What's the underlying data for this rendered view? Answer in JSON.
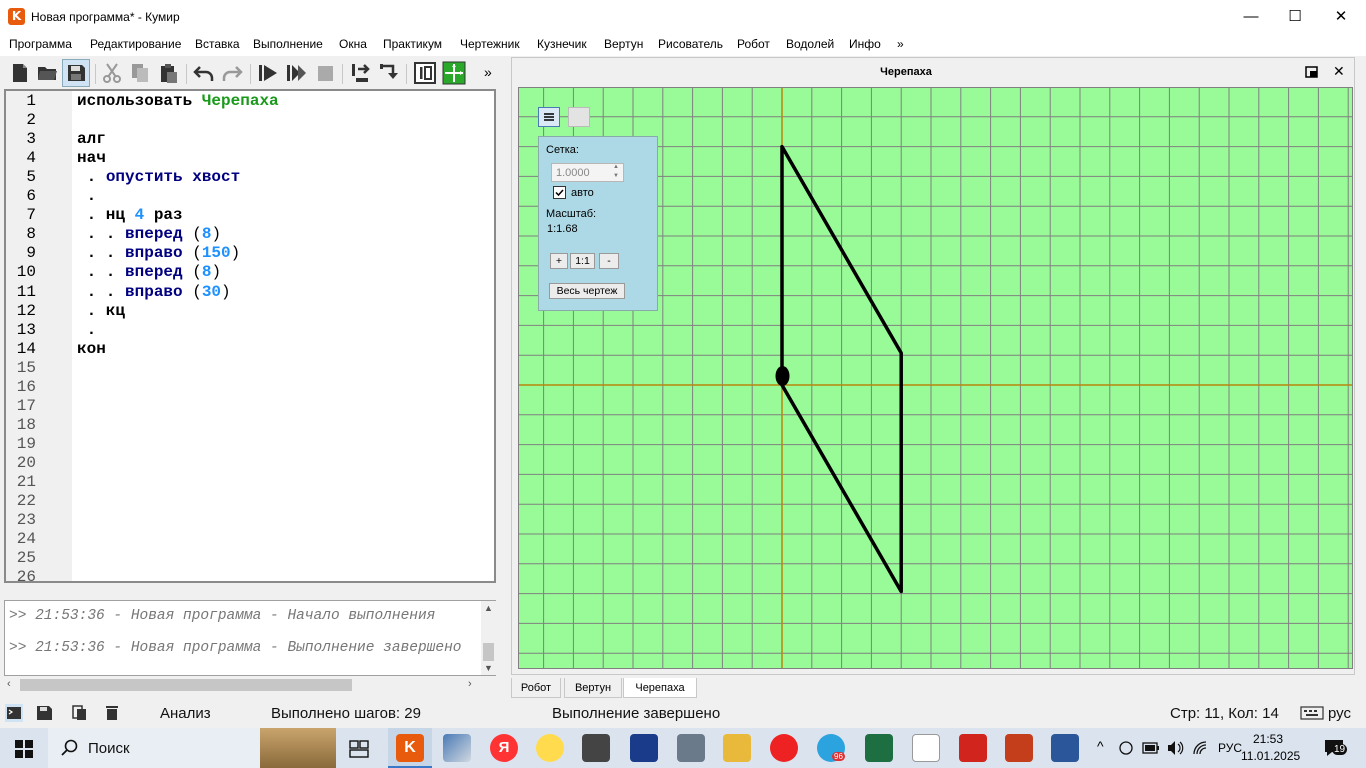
{
  "window": {
    "title": "Новая программа* - Кумир",
    "app_icon_letter": "K",
    "minimize": "—",
    "maximize": "☐",
    "close": "✕"
  },
  "menu": [
    "Программа",
    "Редактирование",
    "Вставка",
    "Выполнение",
    "Окна",
    "Практикум",
    "Чертежник",
    "Кузнечик",
    "Вертун",
    "Рисователь",
    "Робот",
    "Водолей",
    "Инфо",
    "»"
  ],
  "toolbar": {
    "more": "»"
  },
  "editor": {
    "line_numbers": [
      "1",
      "2",
      "3",
      "4",
      "5",
      "6",
      "7",
      "8",
      "9",
      "10",
      "11",
      "12",
      "13",
      "14",
      "15",
      "16",
      "17",
      "18",
      "19",
      "20",
      "21",
      "22",
      "23",
      "24",
      "25",
      "26"
    ],
    "lines": [
      {
        "parts": [
          {
            "t": "использовать ",
            "c": "kwb"
          },
          {
            "t": "Черепаха",
            "c": "mod"
          }
        ]
      },
      {
        "parts": []
      },
      {
        "parts": [
          {
            "t": "алг",
            "c": "kwb"
          }
        ]
      },
      {
        "parts": [
          {
            "t": "нач",
            "c": "kwb"
          }
        ]
      },
      {
        "parts": [
          {
            "t": " . ",
            "c": "kwb"
          },
          {
            "t": "опустить хвост",
            "c": "kw"
          }
        ]
      },
      {
        "parts": [
          {
            "t": " .",
            "c": "kwb"
          }
        ]
      },
      {
        "parts": [
          {
            "t": " . нц ",
            "c": "kwb"
          },
          {
            "t": "4",
            "c": "num"
          },
          {
            "t": " раз",
            "c": "kwb"
          }
        ]
      },
      {
        "parts": [
          {
            "t": " . . ",
            "c": "kwb"
          },
          {
            "t": "вперед",
            "c": "kw"
          },
          {
            "t": " (",
            "c": "par"
          },
          {
            "t": "8",
            "c": "num"
          },
          {
            "t": ")",
            "c": "par"
          }
        ]
      },
      {
        "parts": [
          {
            "t": " . . ",
            "c": "kwb"
          },
          {
            "t": "вправо",
            "c": "kw"
          },
          {
            "t": " (",
            "c": "par"
          },
          {
            "t": "150",
            "c": "num"
          },
          {
            "t": ")",
            "c": "par"
          }
        ]
      },
      {
        "parts": [
          {
            "t": " . . ",
            "c": "kwb"
          },
          {
            "t": "вперед",
            "c": "kw"
          },
          {
            "t": " (",
            "c": "par"
          },
          {
            "t": "8",
            "c": "num"
          },
          {
            "t": ")",
            "c": "par"
          }
        ]
      },
      {
        "parts": [
          {
            "t": " . . ",
            "c": "kwb"
          },
          {
            "t": "вправо",
            "c": "kw"
          },
          {
            "t": " (",
            "c": "par"
          },
          {
            "t": "30",
            "c": "num"
          },
          {
            "t": ")",
            "c": "par"
          }
        ]
      },
      {
        "parts": [
          {
            "t": " . кц",
            "c": "kwb"
          }
        ]
      },
      {
        "parts": [
          {
            "t": " .",
            "c": "kwb"
          }
        ]
      },
      {
        "parts": [
          {
            "t": "кон",
            "c": "kwb"
          }
        ]
      }
    ]
  },
  "console": {
    "lines": [
      ">> 21:53:36 - Новая программа - Начало выполнения",
      ">> 21:53:36 - Новая программа - Выполнение завершено"
    ]
  },
  "status": {
    "mode": "Анализ",
    "steps": "Выполнено шагов: 29",
    "message": "Выполнение завершено",
    "position": "Стр: 11, Кол: 14",
    "lang": "рус"
  },
  "turtle_panel": {
    "title": "Черепаха",
    "grid_label": "Сетка:",
    "grid_value": "1.0000",
    "auto_label": "авто",
    "auto_checked": true,
    "scale_label": "Масштаб:",
    "scale_value": "1:1.68",
    "zoom_in": "+",
    "zoom_reset": "1:1",
    "zoom_out": "-",
    "fit_all": "Весь чертеж"
  },
  "tabs": [
    "Робот",
    "Вертун",
    "Черепаха"
  ],
  "active_tab": "Черепаха",
  "taskbar": {
    "search_placeholder": "Поиск",
    "time": "21:53",
    "date": "11.01.2025",
    "lang": "РУС",
    "notifications": "19",
    "telegram_badge": "96"
  },
  "colors": {
    "canvas_bg": "#98fb98",
    "grid": "#808080",
    "axis": "#b8860b",
    "turtle_path": "#000000",
    "popup_bg": "#add8e6",
    "module_green": "#1a9a1a",
    "keyword_blue": "#000080",
    "number_blue": "#1e90ff"
  }
}
